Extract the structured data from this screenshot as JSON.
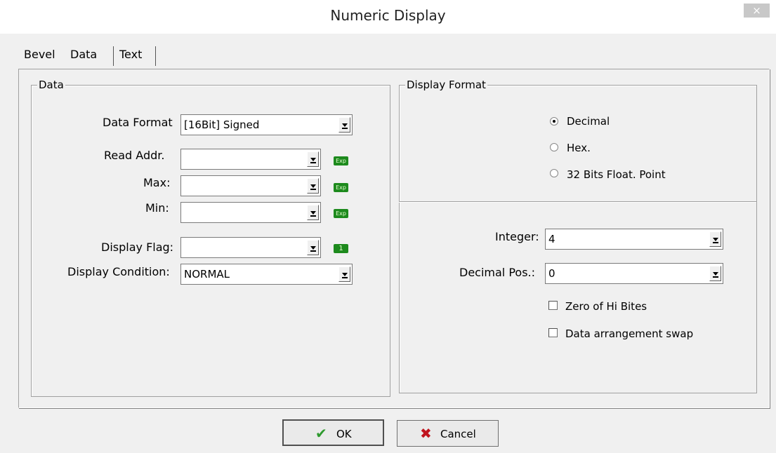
{
  "window": {
    "title": "Numeric Display",
    "close_glyph": "×"
  },
  "tabs": [
    {
      "label": "Bevel"
    },
    {
      "label": "Data"
    },
    {
      "label": "Text"
    }
  ],
  "data_group": {
    "title": "Data",
    "data_format": {
      "label": "Data Format",
      "value": "[16Bit] Signed"
    },
    "read_addr": {
      "label": "Read Addr.",
      "value": "",
      "icon": "exp-icon",
      "icon_text": "Exp"
    },
    "max": {
      "label": "Max:",
      "value": "",
      "icon": "exp-icon",
      "icon_text": "Exp"
    },
    "min": {
      "label": "Min:",
      "value": "",
      "icon": "exp-icon",
      "icon_text": "Exp"
    },
    "display_flag": {
      "label": "Display Flag:",
      "value": "",
      "icon": "bit-icon",
      "icon_text": "1"
    },
    "display_condition": {
      "label": "Display Condition:",
      "value": "NORMAL"
    }
  },
  "format_group": {
    "title": "Display Format",
    "radios": [
      {
        "label": "Decimal",
        "checked": true
      },
      {
        "label": "Hex.",
        "checked": false
      },
      {
        "label": "32 Bits Float. Point",
        "checked": false
      }
    ],
    "integer": {
      "label": "Integer:",
      "value": "4"
    },
    "decimal_pos": {
      "label": "Decimal Pos.:",
      "value": "0"
    },
    "checkboxes": [
      {
        "label": "Zero of Hi Bites",
        "checked": false
      },
      {
        "label": "Data arrangement swap",
        "checked": false
      }
    ]
  },
  "buttons": {
    "ok": {
      "label": "OK",
      "icon": "checkmark-icon"
    },
    "cancel": {
      "label": "Cancel",
      "icon": "cross-icon"
    }
  },
  "colors": {
    "accent_green": "#1d8a1d",
    "cancel_red": "#c0141e",
    "ok_green": "#2e9a2e"
  }
}
